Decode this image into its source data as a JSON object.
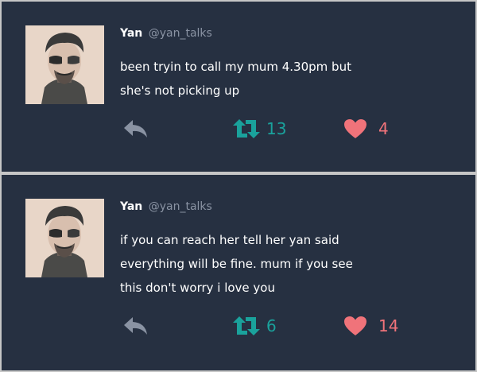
{
  "tweets": [
    {
      "author_name": "Yan",
      "author_handle": "@yan_talks",
      "avatar_icon": "avatar-portrait",
      "text_lines": [
        "been tryin to call my mum 4.30pm but",
        "she's not picking up"
      ],
      "retweet_count": "13",
      "like_count": "4"
    },
    {
      "author_name": "Yan",
      "author_handle": "@yan_talks",
      "avatar_icon": "avatar-portrait",
      "text_lines": [
        "if you can reach her tell her yan said",
        "everything will be fine. mum if you see",
        "this don't worry i love you"
      ],
      "retweet_count": "6",
      "like_count": "14"
    }
  ],
  "icons": {
    "reply": "reply-icon",
    "retweet": "retweet-icon",
    "like": "heart-icon"
  },
  "colors": {
    "card_background": "#263041",
    "retweet": "#1aa29c",
    "like": "#f0737a",
    "reply": "#8a93a3",
    "handle": "#8a93a3"
  }
}
